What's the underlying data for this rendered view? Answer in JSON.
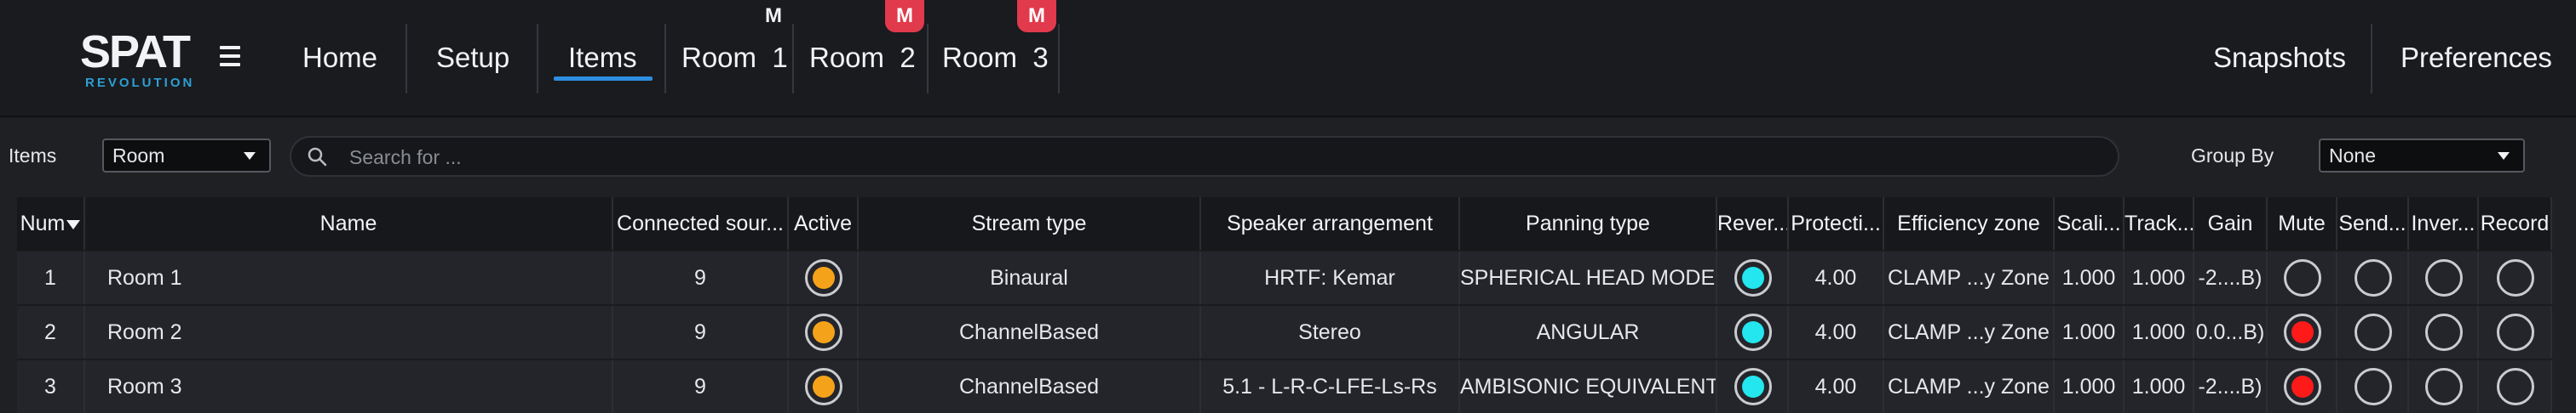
{
  "logo": {
    "main": "SPAT",
    "sub": "REVOLUTION"
  },
  "nav": {
    "home": "Home",
    "setup": "Setup",
    "items": "Items",
    "rooms": [
      {
        "label": "Room  1",
        "badge": "M",
        "badge_style": "plain"
      },
      {
        "label": "Room  2",
        "badge": "M",
        "badge_style": "red"
      },
      {
        "label": "Room  3",
        "badge": "M",
        "badge_style": "red"
      }
    ],
    "snapshots": "Snapshots",
    "preferences": "Preferences"
  },
  "filter": {
    "items_label": "Items",
    "items_select": "Room",
    "search_placeholder": "Search for ...",
    "group_by_label": "Group By",
    "group_by_select": "None"
  },
  "colors": {
    "accent": "#2d8ee0",
    "badge_red": "#e03a4c",
    "active_orange": "#f5a21b",
    "reverb_cyan": "#23e6ee",
    "mute_red": "#ff1a1a"
  },
  "table": {
    "headers": [
      "Num",
      "Name",
      "Connected sour...",
      "Active",
      "Stream type",
      "Speaker arrangement",
      "Panning type",
      "Rever...",
      "Protecti...",
      "Efficiency zone",
      "Scali...",
      "Track...",
      "Gain",
      "Mute",
      "Send...",
      "Inver...",
      "Record"
    ],
    "rows": [
      {
        "num": "1",
        "name": "Room  1",
        "connected": "9",
        "active": true,
        "stream": "Binaural",
        "speaker": "HRTF: Kemar",
        "panning": "SPHERICAL HEAD MODEL",
        "reverb": true,
        "protection": "4.00",
        "efficiency": "CLAMP ...y Zone",
        "scaling": "1.000",
        "tracking": "1.000",
        "gain": "-2....B)",
        "mute": false,
        "send": false,
        "invert": false,
        "record": false
      },
      {
        "num": "2",
        "name": "Room  2",
        "connected": "9",
        "active": true,
        "stream": "ChannelBased",
        "speaker": "Stereo",
        "panning": "ANGULAR",
        "reverb": true,
        "protection": "4.00",
        "efficiency": "CLAMP ...y Zone",
        "scaling": "1.000",
        "tracking": "1.000",
        "gain": "0.0...B)",
        "mute": true,
        "send": false,
        "invert": false,
        "record": false
      },
      {
        "num": "3",
        "name": "Room  3",
        "connected": "9",
        "active": true,
        "stream": "ChannelBased",
        "speaker": "5.1 - L-R-C-LFE-Ls-Rs",
        "panning": "AMBISONIC EQUIVALENT",
        "reverb": true,
        "protection": "4.00",
        "efficiency": "CLAMP ...y Zone",
        "scaling": "1.000",
        "tracking": "1.000",
        "gain": "-2....B)",
        "mute": true,
        "send": false,
        "invert": false,
        "record": false
      }
    ]
  }
}
